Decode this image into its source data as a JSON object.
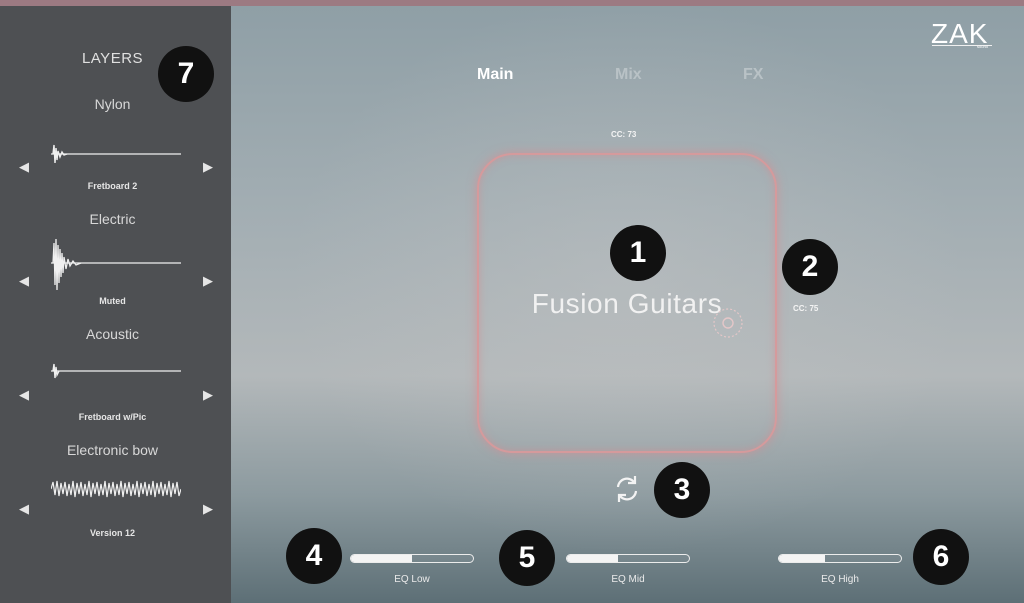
{
  "sidebar": {
    "title": "LAYERS",
    "layers": [
      {
        "name": "Nylon",
        "preset": "Fretboard 2"
      },
      {
        "name": "Electric",
        "preset": "Muted"
      },
      {
        "name": "Acoustic",
        "preset": "Fretboard w/Pic"
      },
      {
        "name": "Electronic bow",
        "preset": "Version 12"
      }
    ],
    "arrow_left": "◀",
    "arrow_right": "▶"
  },
  "brand": {
    "logo": "ZAK",
    "sub": "sound"
  },
  "tabs": [
    {
      "label": "Main",
      "active": true
    },
    {
      "label": "Mix",
      "active": false
    },
    {
      "label": "FX",
      "active": false
    }
  ],
  "pad": {
    "title": "Fusion Guitars",
    "cc_top": "CC: 73",
    "cc_right": "CC: 75",
    "border_color": "#d59a9c"
  },
  "sliders": [
    {
      "label": "EQ Low",
      "value": 0.5
    },
    {
      "label": "EQ Mid",
      "value": 0.42
    },
    {
      "label": "EQ High",
      "value": 0.38
    }
  ],
  "callouts": [
    "1",
    "2",
    "3",
    "4",
    "5",
    "6",
    "7"
  ],
  "icons": {
    "refresh": "refresh-icon",
    "target": "target-icon"
  }
}
